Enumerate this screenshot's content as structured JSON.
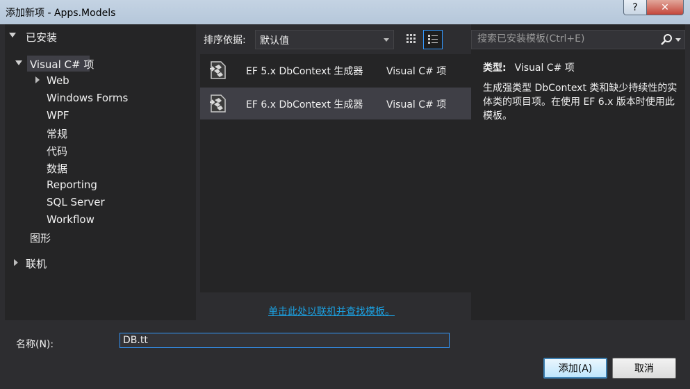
{
  "window": {
    "title": "添加新项 - Apps.Models",
    "help_label": "?",
    "close_label": "✕"
  },
  "sidebar": {
    "installed_label": "已安装",
    "visual_csharp_label": "Visual C# 项",
    "children": [
      "Web",
      "Windows Forms",
      "WPF",
      "常规",
      "代码",
      "数据",
      "Reporting",
      "SQL Server",
      "Workflow"
    ],
    "graphics_label": "图形",
    "online_label": "联机"
  },
  "toolbar": {
    "sort_label": "排序依据:",
    "sort_value": "默认值"
  },
  "templates": [
    {
      "name": "EF 5.x DbContext 生成器",
      "language": "Visual C# 项",
      "selected": false
    },
    {
      "name": "EF 6.x DbContext 生成器",
      "language": "Visual C# 项",
      "selected": true
    }
  ],
  "search": {
    "placeholder": "搜索已安装模板(Ctrl+E)"
  },
  "details": {
    "type_label": "类型:",
    "type_value": "Visual C# 项",
    "description": "生成强类型 DbContext 类和缺少持续性的实体类的项目项。在使用 EF 6.x 版本时使用此模板。"
  },
  "online_link": "单击此处以联机并查找模板。",
  "name_field": {
    "label": "名称(N):",
    "value": "DB.tt"
  },
  "buttons": {
    "add": "添加(A)",
    "cancel": "取消"
  },
  "colors": {
    "accent": "#3399ff",
    "link": "#1ba1e2",
    "background": "#2d2d30",
    "panel": "#252526"
  }
}
